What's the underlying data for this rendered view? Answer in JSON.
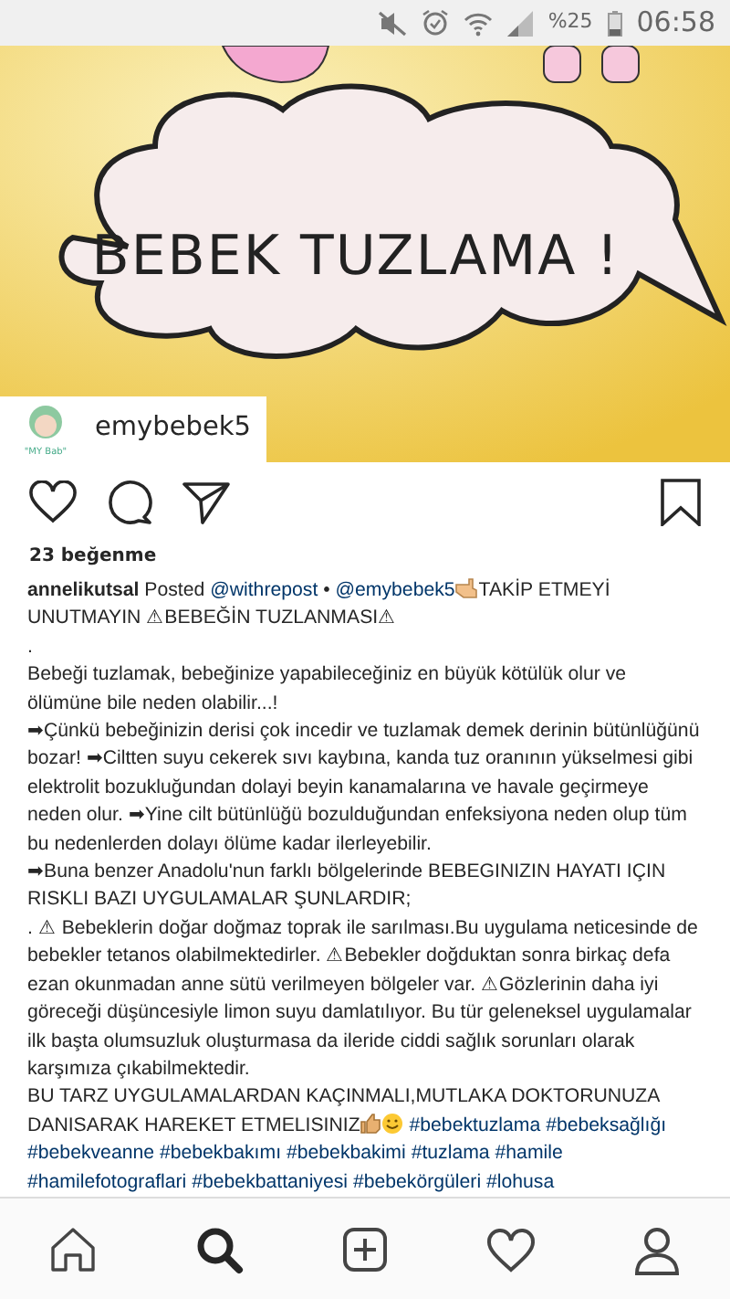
{
  "status_bar": {
    "battery_percent": "%25",
    "time": "06:58"
  },
  "post": {
    "image_text": "BEBEK TUZLAMA !",
    "username": "emybebek5",
    "avatar_text": "\"MY Bab\"",
    "likes": "23 beğenme",
    "saved": false,
    "caption": [
      [
        {
          "kind": "username",
          "text": "annelikutsal"
        },
        {
          "kind": "text",
          "text": " Posted "
        },
        {
          "kind": "mention",
          "text": "@withrepost"
        },
        {
          "kind": "text",
          "text": " • "
        },
        {
          "kind": "mention",
          "text": "@emybebek5"
        },
        {
          "kind": "hand_icon"
        },
        {
          "kind": "text",
          "text": "TAKİP ETMEYİ UNUTMAYIN ⚠BEBEĞİN TUZLANMASI⚠"
        }
      ],
      [
        {
          "kind": "text",
          "text": "."
        }
      ],
      [
        {
          "kind": "text",
          "text": "Bebeği tuzlamak, bebeğinize yapabileceğiniz en büyük kötülük olur ve ölümüne bile neden olabilir...!"
        }
      ],
      [
        {
          "kind": "text",
          "text": "➡Çünkü bebeğinizin derisi çok incedir ve tuzlamak demek  derinin bütünlüğünü bozar! ➡Ciltten suyu cekerek sıvı kaybına, kanda tuz oranının yükselmesi gibi elektrolit bozukluğundan dolayi beyin kanamalarına ve havale geçirmeye neden olur. ➡Yine cilt bütünlüğü bozulduğundan enfeksiyona neden olup tüm bu nedenlerden dolayı ölüme kadar ilerleyebilir."
        }
      ],
      [
        {
          "kind": "text",
          "text": "➡Buna benzer Anadolu'nun farklı bölgelerinde BEBEGINIZIN HAYATI IÇIN RISKLI BAZI UYGULAMALAR  ŞUNLARDIR;"
        }
      ],
      [
        {
          "kind": "text",
          "text": ". ⚠ Bebeklerin doğar doğmaz toprak ile sarılması.Bu uygulama neticesinde de bebekler tetanos olabilmektedirler. ⚠Bebekler doğduktan sonra birkaç defa ezan okunmadan anne sütü verilmeyen bölgeler var. ⚠Gözlerinin daha iyi göreceği düşüncesiyle limon suyu damlatılıyor. Bu tür geleneksel uygulamalar ilk başta olumsuzluk oluşturmasa da ileride ciddi sağlık sorunları olarak karşımıza çıkabilmektedir."
        }
      ],
      [
        {
          "kind": "text",
          "text": "BU TARZ UYGULAMALARDAN KAÇINMALI,MUTLAKA DOKTORUNUZA DANISARAK HAREKET ETMELISINIZ"
        },
        {
          "kind": "thumbs_icon"
        },
        {
          "kind": "smile_icon"
        },
        {
          "kind": "hashtag",
          "text": "#bebektuzlama"
        },
        {
          "kind": "hashtag",
          "text": "#bebeksağlığı"
        },
        {
          "kind": "hashtag",
          "text": "#bebekveanne"
        },
        {
          "kind": "hashtag",
          "text": "#bebekbakımı"
        },
        {
          "kind": "hashtag",
          "text": "#bebekbakimi"
        },
        {
          "kind": "hashtag",
          "text": "#tuzlama"
        },
        {
          "kind": "hashtag",
          "text": "#hamile"
        },
        {
          "kind": "hashtag",
          "text": "#hamilefotograflari"
        },
        {
          "kind": "hashtag",
          "text": "#bebekbattaniyesi"
        },
        {
          "kind": "hashtag",
          "text": "#bebekörgüleri"
        },
        {
          "kind": "hashtag",
          "text": "#lohusa"
        }
      ]
    ]
  },
  "bottom_nav": [
    {
      "kind": "home",
      "selected": false
    },
    {
      "kind": "search",
      "selected": true
    },
    {
      "kind": "add",
      "selected": false
    },
    {
      "kind": "activity",
      "selected": false
    },
    {
      "kind": "profile",
      "selected": false
    }
  ]
}
